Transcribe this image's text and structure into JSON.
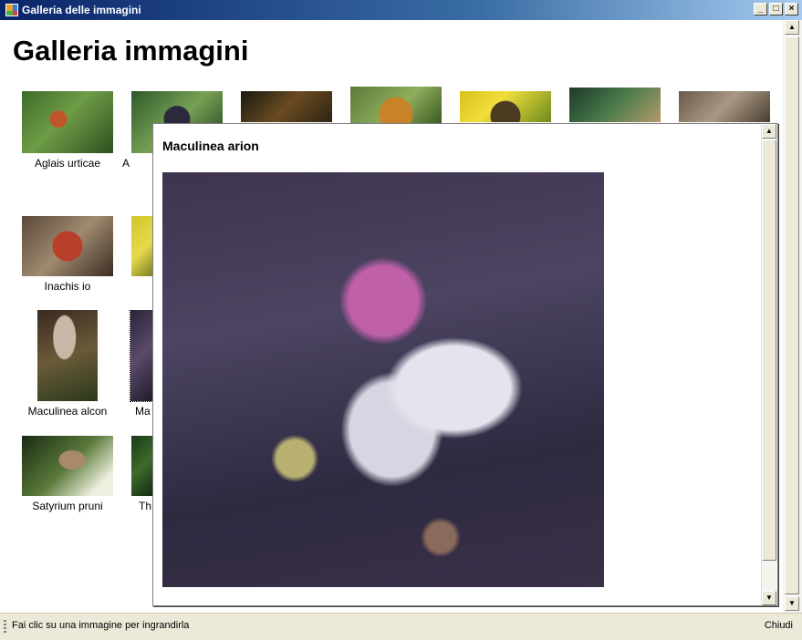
{
  "window": {
    "title": "Galleria delle immagini",
    "controls": {
      "minimize": "_",
      "maximize": "□",
      "close": "×"
    }
  },
  "gallery": {
    "title": "Galleria immagini",
    "thumbnails": [
      {
        "label": "Aglais urticae"
      },
      {
        "label": "A"
      },
      {
        "label": ""
      },
      {
        "label": ""
      },
      {
        "label": ""
      },
      {
        "label": ""
      },
      {
        "label": ""
      },
      {
        "label": "Inachis io"
      },
      {
        "label": ""
      },
      {
        "label": "Maculinea alcon"
      },
      {
        "label": "Ma"
      },
      {
        "label": "Satyrium pruni"
      },
      {
        "label": "Th"
      }
    ]
  },
  "preview": {
    "title": "Maculinea arion",
    "image_icon": "butterfly-photo"
  },
  "statusbar": {
    "text": "Fai clic su una immagine per ingrandirla",
    "close_label": "Chiudi"
  }
}
